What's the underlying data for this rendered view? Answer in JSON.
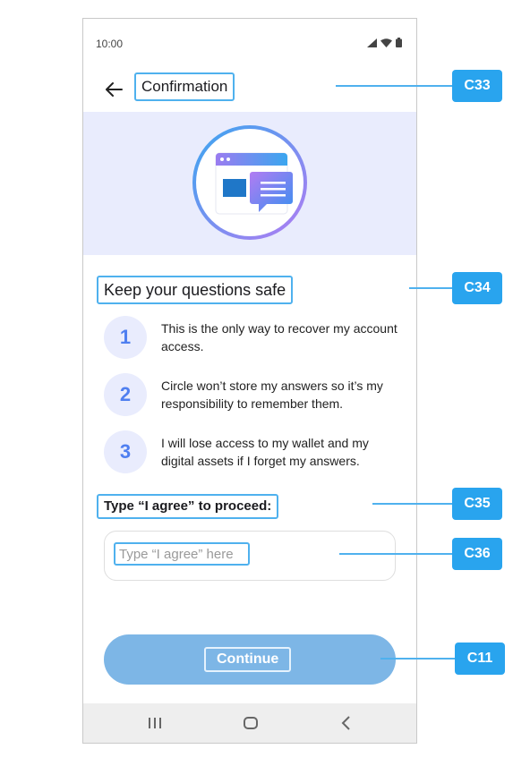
{
  "status_bar": {
    "time": "10:00"
  },
  "header": {
    "title": "Confirmation"
  },
  "content": {
    "section_title": "Keep your questions safe",
    "steps": [
      {
        "number": "1",
        "text": "This is the only way to recover my account access."
      },
      {
        "number": "2",
        "text": "Circle won’t store my answers so it’s my responsibility to remember them."
      },
      {
        "number": "3",
        "text": "I will lose access to my wallet and my digital assets if I forget my answers."
      }
    ],
    "agree_label": "Type “I agree” to proceed:",
    "agree_placeholder": "Type “I agree” here",
    "agree_value": "",
    "continue_label": "Continue"
  },
  "callouts": {
    "c33": "C33",
    "c34": "C34",
    "c35": "C35",
    "c36": "C36",
    "c11": "C11"
  },
  "colors": {
    "accent": "#4fb1ee",
    "callout": "#29a4ee",
    "button": "#7db6e6",
    "hero_bg": "#e9ecfd"
  }
}
